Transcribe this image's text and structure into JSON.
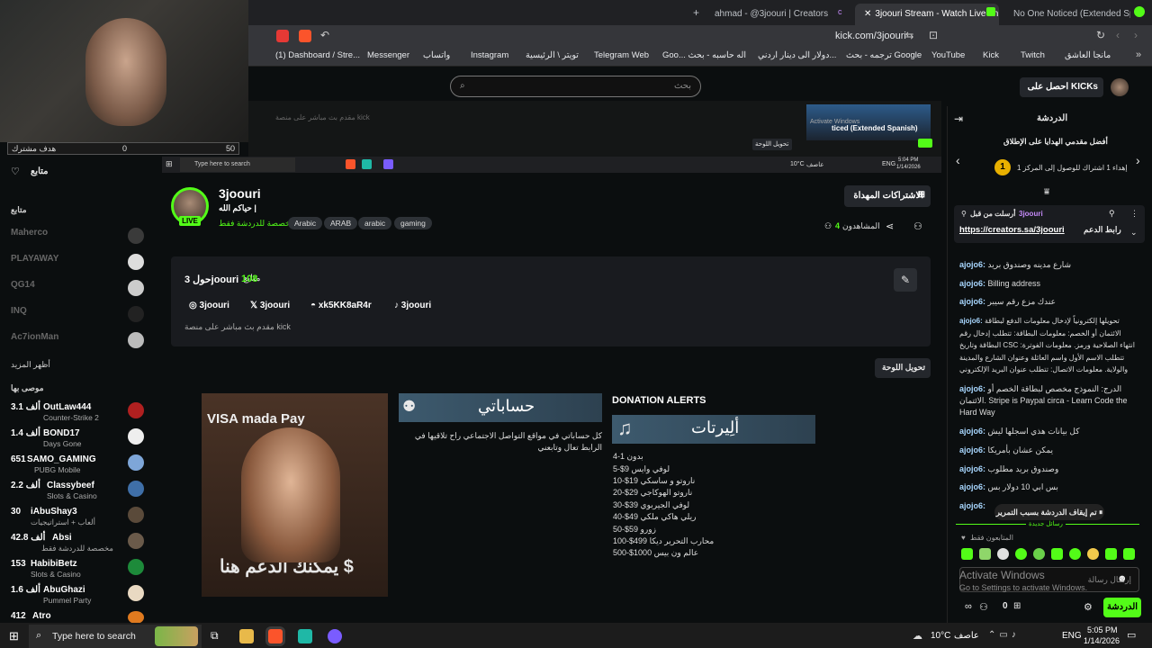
{
  "browser": {
    "tabs": [
      {
        "label": "ahmad - @3joouri | Creators"
      },
      {
        "label": "3joouri Stream - Watch Live on K"
      },
      {
        "label": "No One Noticed (Extended Spanis"
      }
    ],
    "url": "kick.com/3joouri",
    "bookmarks": [
      {
        "label": "(1) Dashboard / Stre...",
        "color": "#e53935"
      },
      {
        "label": "Messenger",
        "color": "#448aff"
      },
      {
        "label": "واتساب",
        "color": "#25d366"
      },
      {
        "label": "Instagram",
        "color": "#e1306c"
      },
      {
        "label": "تويتر \\ الرئيسية",
        "color": "#ffffff"
      },
      {
        "label": "Telegram Web",
        "color": "#2aa3e0"
      },
      {
        "label": "Goo... اله حاسبه - بحث",
        "color": "#ffffff"
      },
      {
        "label": "دولار الى دينار اردني...",
        "color": "#ffffff"
      },
      {
        "label": "ترجمه - بحث Google",
        "color": "#ffffff"
      },
      {
        "label": "YouTube",
        "color": "#ff0000"
      },
      {
        "label": "Kick",
        "color": "#53fc18"
      },
      {
        "label": "Twitch",
        "color": "#9146ff"
      },
      {
        "label": "مانجا العاشق",
        "color": "#e53935"
      }
    ]
  },
  "header": {
    "search_placeholder": "بحث",
    "get_kicks": "احصل على KICKs"
  },
  "webcam": {
    "sub_goal_label": "هدف مشترك",
    "sub_goal_current": "0",
    "sub_goal_target": "50"
  },
  "embedded": {
    "edit_panel": "تحويل اللوحة",
    "now_playing": "ticed (Extended Spanish)",
    "activate": "Activate Windows",
    "search_text": "Type here to search",
    "temp": "10°C",
    "weather": "عاصف",
    "lang": "ENG",
    "time": "5:04 PM",
    "date": "1/14/2026"
  },
  "sidebar": {
    "following_title": "متابع",
    "following_section": "متابع",
    "following": [
      {
        "name": "Maherco"
      },
      {
        "name": "PLAYAWAY"
      },
      {
        "name": "QG14"
      },
      {
        "name": "INQ"
      },
      {
        "name": "Ac7ionMan"
      }
    ],
    "show_more": "أظهر المزيد",
    "recommended_title": "موصى بها",
    "recommended": [
      {
        "count": "3.1 ألف",
        "name": "OutLaw444",
        "sub": "Counter-Strike 2"
      },
      {
        "count": "1.4 ألف",
        "name": "BOND17",
        "sub": "Days Gone"
      },
      {
        "count": "651",
        "name": "SAMO_GAMING",
        "sub": "PUBG Mobile"
      },
      {
        "count": "2.2 ألف",
        "name": "Classybeef",
        "sub": "Slots & Casino"
      },
      {
        "count": "30",
        "name": "iAbuShay3",
        "sub": "ألعاب + استراتيجيات"
      },
      {
        "count": "42.8 ألف",
        "name": "Absi",
        "sub": "مخصصة للدردشة فقط"
      },
      {
        "count": "153",
        "name": "HabibiBetz",
        "sub": "Slots & Casino"
      },
      {
        "count": "1.6 ألف",
        "name": "AbuGhazi",
        "sub": "Pummel Party"
      },
      {
        "count": "412",
        "name": "Atro",
        "sub": ""
      }
    ]
  },
  "channel": {
    "name": "3joouri",
    "tagline": "حياكم الله |",
    "category": "مخصصة للدردشة فقط",
    "live": "LIVE",
    "tags": [
      "Arabic",
      "ARAB",
      "arabic",
      "gaming"
    ],
    "viewers_label": "المشاهدون",
    "viewers_count": "4",
    "subscribe_gifts": "الاشتراكات المهداة"
  },
  "about": {
    "heading_name": "حول 3joouri",
    "followers_count": "108",
    "followers_label": "متابع",
    "instagram": "3joouri",
    "x": "3joouri",
    "discord": "xk5KK8aR4r",
    "tiktok": "3joouri",
    "description": "مقدم بث مباشر على منصة kick",
    "edit_panels": "تحويل اللوحة"
  },
  "panels": {
    "payments": "VISA  mada  Pay",
    "support_text": "يمكنك الدعم هنا $",
    "accounts_banner": "حساباتي",
    "accounts_desc": "كل حساباتي في مواقع التواصل الاجتماعي راح تلاقيها في الرابط تعال وتابعني",
    "alerts_title": "DONATION ALERTS",
    "alerts_banner": "ألِيرتات",
    "alerts": [
      "بدون 1-4",
      "لوفي وايس 9$-5",
      "ناروتو و ساسكي 19$-10",
      "ناروتو الهوكاجي 29$-20",
      "لوفي الجيربوي 39$-30",
      "ريلي هاكي ملكي 49$-40",
      "زورو 59$-50",
      "محارب التحرير ديكا 499$-100",
      "عالم ون بيس 1000$-500"
    ]
  },
  "chat": {
    "title": "الدردشة",
    "top_gifters": "أفضل مقدمي الهدايا على الإطلاق",
    "gift_note": "إهداء 1 اشتراك للوصول إلى المركز 1",
    "gift_rank": "1",
    "pinned_by_label": "أرسلت من قبل",
    "pinned_by": "3joouri",
    "pinned_link": "https://creators.sa/3joouri",
    "pinned_label": "رابط الدعم",
    "messages": [
      {
        "user": "ajojo6:",
        "text": "شارع مدينه وصندوق بريد"
      },
      {
        "user": "ajojo6:",
        "text": "Billing address"
      },
      {
        "user": "ajojo6:",
        "text": "عندك مزع رقم سيبر"
      },
      {
        "user": "ajojo6:",
        "text": "تحويلها إلكترونياً لإدخال معلومات الدفع لبطاقة الائتمان أو الخصم: معلومات البطاقة: تتطلب إدخال رقم البطاقة وتاريخ CSC انتهاء الصلاحية ورمز. معلومات الفوترة: تتطلب الاسم الأول واسم العائلة وعنوان الشارع والمدينة والولاية. معلومات الاتصال: تتطلب عنوان البريد الإلكتروني"
      },
      {
        "user": "ajojo6:",
        "text": "الدرج: النموذج مخصص لبطاقة الخصم أو الائتمان. Stripe is Paypal circa - Learn Code the Hard Way"
      },
      {
        "user": "ajojo6:",
        "text": "كل بيانات هذي اسجلها ليش"
      },
      {
        "user": "ajojo6:",
        "text": "يمكن عشان بأمريكا"
      },
      {
        "user": "ajojo6:",
        "text": "وصندوق بريد مطلوب"
      },
      {
        "user": "ajojo6:",
        "text": "بس ابي 10 دولار بس"
      },
      {
        "user": "ajojo6:",
        "text": ""
      }
    ],
    "paused": "تم إيقاف الدردشة بسبب التمرير",
    "new_messages": "رسائل جديدة",
    "followers_only": "المتابعون فقط",
    "input_placeholder": "إرسال رسالة",
    "send": "الدردشة",
    "kicks_count": "0",
    "activate_title": "Activate Windows",
    "activate_sub": "Go to Settings to activate Windows."
  },
  "taskbar": {
    "search_text": "Type here to search",
    "temp": "10°C",
    "weather": "عاصف",
    "lang": "ENG",
    "time": "5:05 PM",
    "date": "1/14/2026"
  }
}
